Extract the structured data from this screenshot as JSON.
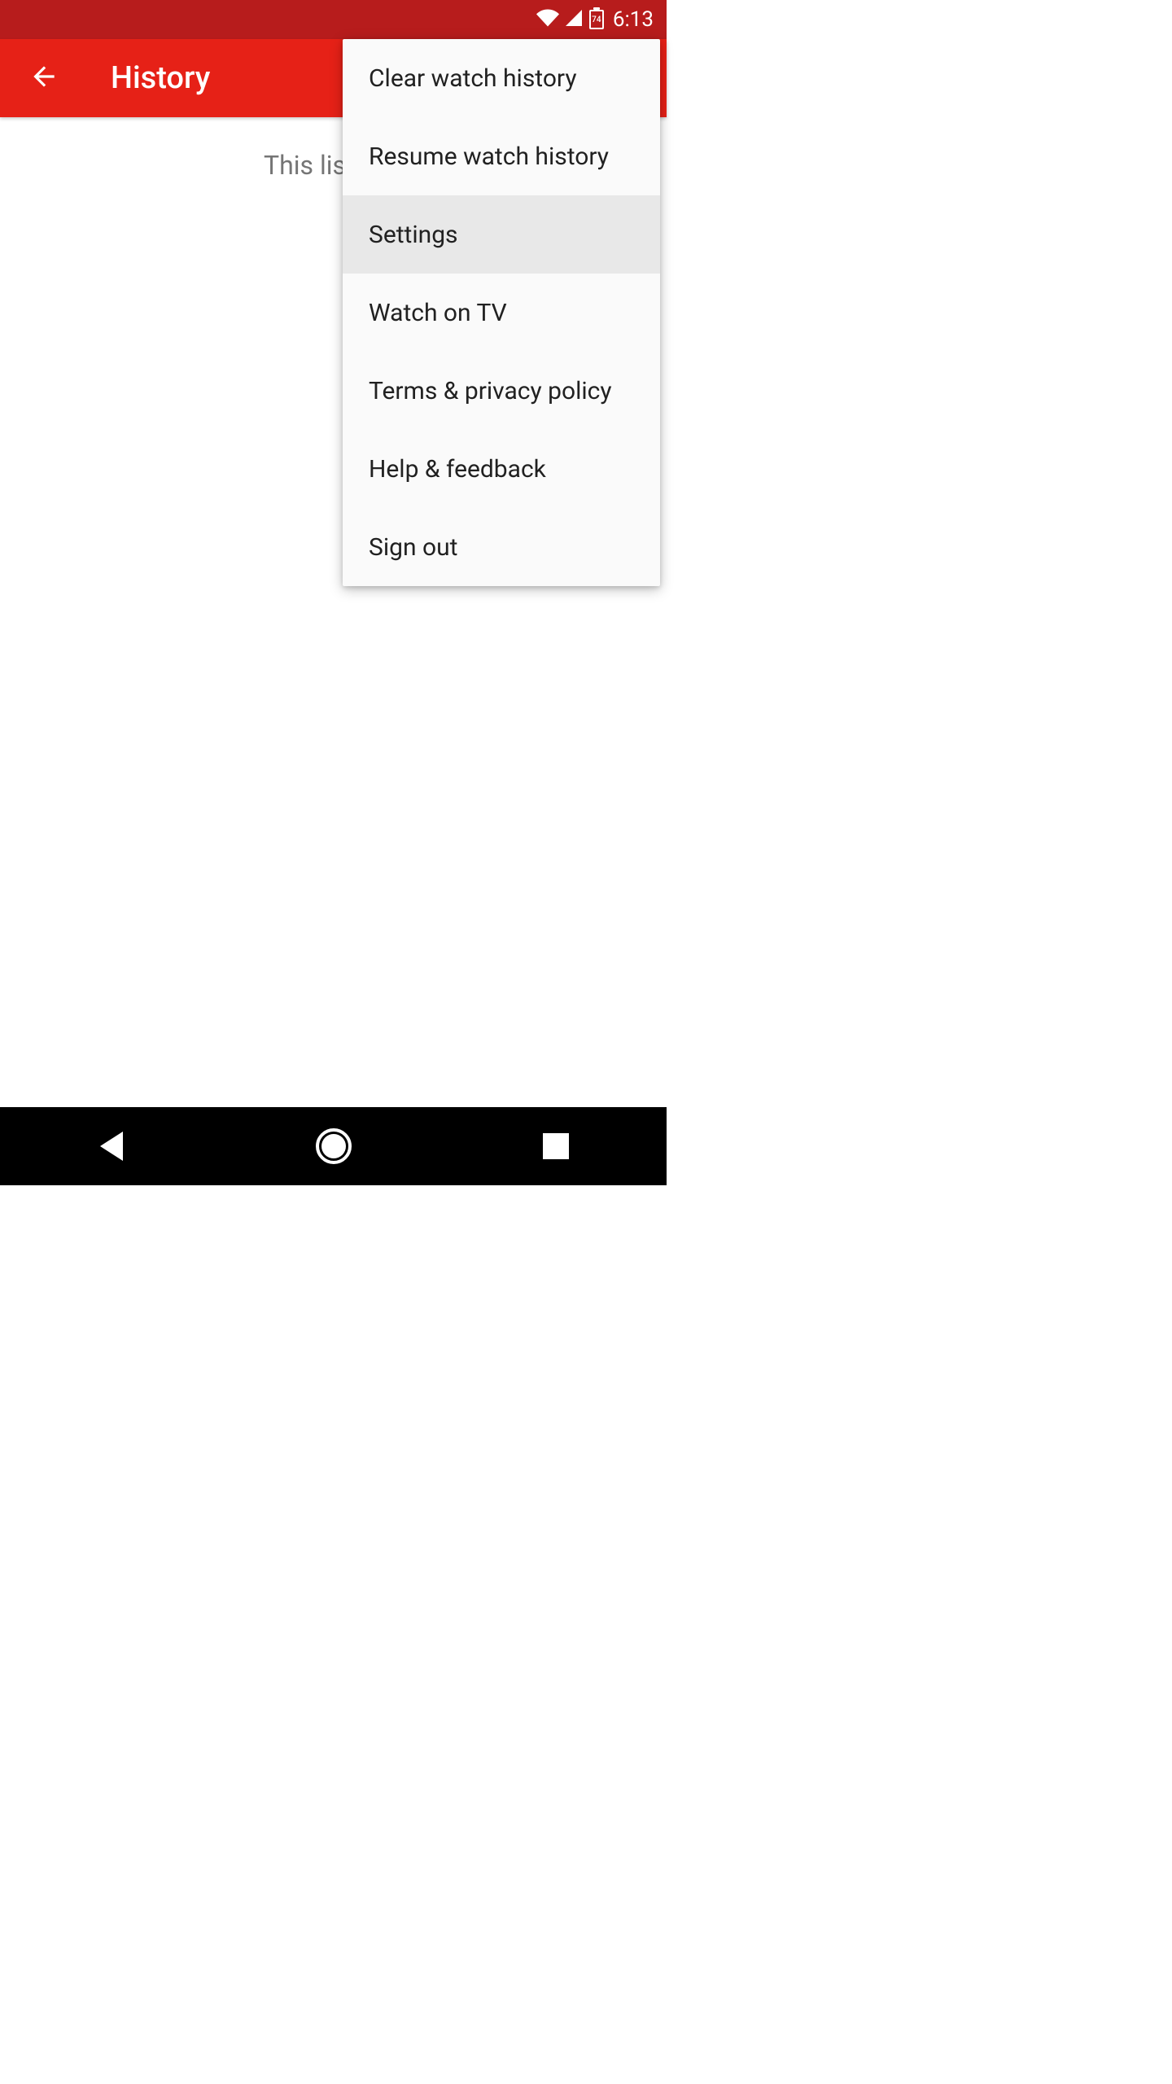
{
  "status_bar": {
    "battery_level": "74",
    "clock": "6:13"
  },
  "app_bar": {
    "title": "History"
  },
  "content": {
    "empty_message": "This list has"
  },
  "menu": {
    "items": [
      {
        "label": "Clear watch history",
        "highlighted": false
      },
      {
        "label": "Resume watch history",
        "highlighted": false
      },
      {
        "label": "Settings",
        "highlighted": true
      },
      {
        "label": "Watch on TV",
        "highlighted": false
      },
      {
        "label": "Terms & privacy policy",
        "highlighted": false
      },
      {
        "label": "Help & feedback",
        "highlighted": false
      },
      {
        "label": "Sign out",
        "highlighted": false
      }
    ]
  }
}
